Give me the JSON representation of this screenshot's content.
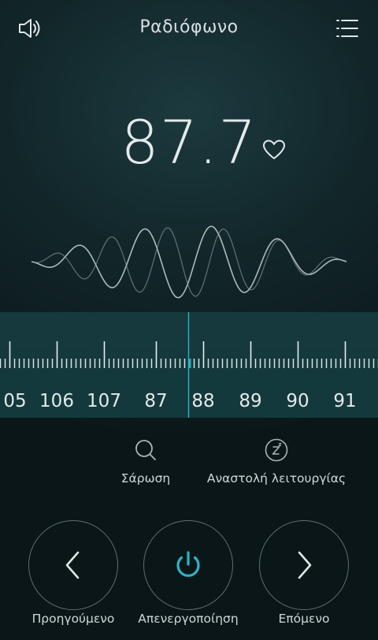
{
  "header": {
    "title": "Ραδιόφωνο",
    "volume_icon": "speaker-icon",
    "menu_icon": "list-menu-icon"
  },
  "tuner": {
    "frequency": "87.7",
    "favorite_icon": "heart-outline-icon",
    "dial_labels": [
      "05",
      "106",
      "107",
      "87",
      "88",
      "89",
      "90",
      "91"
    ]
  },
  "tools": {
    "scan": {
      "label": "Σάρωση",
      "icon": "search-icon"
    },
    "sleep": {
      "label": "Αναστολή λειτουργίας",
      "icon": "sleep-timer-icon"
    }
  },
  "controls": {
    "previous": {
      "label": "Προηγούμενο",
      "icon": "chevron-left-icon"
    },
    "power": {
      "label": "Απενεργοποίηση",
      "icon": "power-icon"
    },
    "next": {
      "label": "Επόμενο",
      "icon": "chevron-right-icon"
    }
  },
  "colors": {
    "accent": "#29b6c4",
    "dial_background": "#15393c",
    "background": "#122629"
  }
}
